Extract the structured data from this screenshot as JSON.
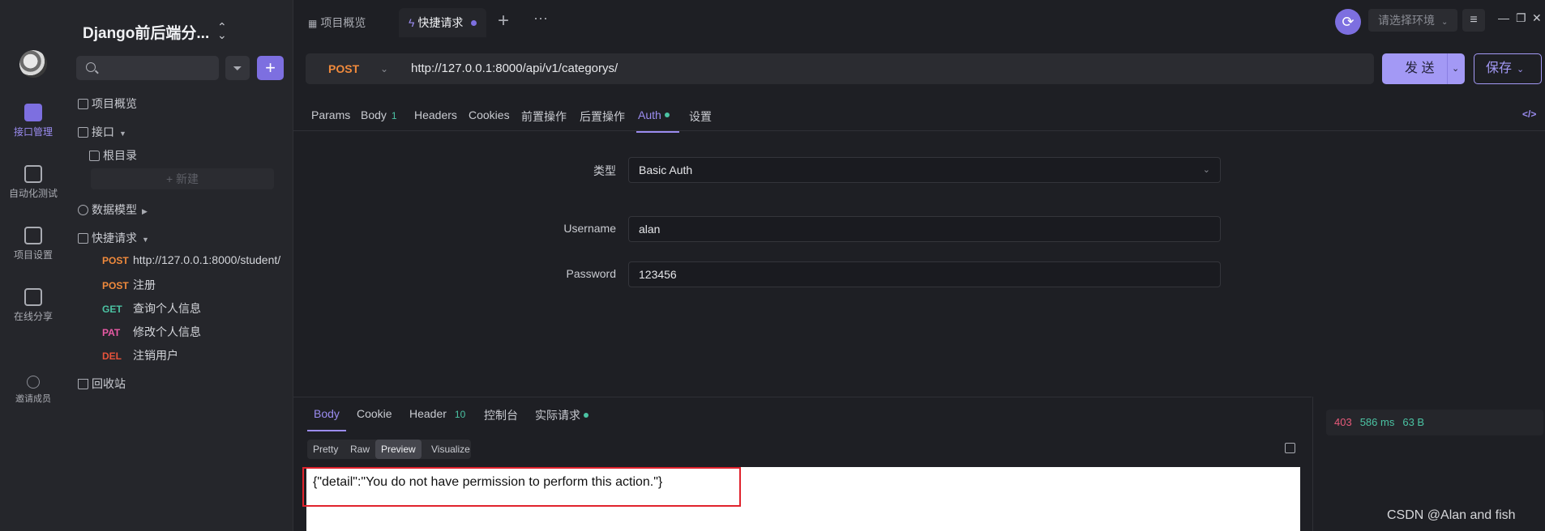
{
  "rail": {
    "items": [
      {
        "label": "接口管理",
        "icon": "api-icon"
      },
      {
        "label": "自动化测试",
        "icon": "automation-icon"
      },
      {
        "label": "项目设置",
        "icon": "settings-icon"
      },
      {
        "label": "在线分享",
        "icon": "share-icon"
      },
      {
        "label": "邀请成员",
        "icon": "invite-icon"
      }
    ]
  },
  "sidebar": {
    "project_title": "Django前后端分...",
    "tree": {
      "overview": "项目概览",
      "apis": "接口",
      "root": "根目录",
      "new": "+ 新建",
      "models": "数据模型",
      "quick": "快捷请求",
      "trash": "回收站"
    },
    "requests": [
      {
        "method": "POST",
        "name": "http://127.0.0.1:8000/student/",
        "color": "#f08a3c"
      },
      {
        "method": "POST",
        "name": "注册",
        "color": "#f08a3c"
      },
      {
        "method": "GET",
        "name": "查询个人信息",
        "color": "#4bc3a3"
      },
      {
        "method": "PAT",
        "name": "修改个人信息",
        "color": "#e85aa5"
      },
      {
        "method": "DEL",
        "name": "注销用户",
        "color": "#e8533b"
      }
    ]
  },
  "tabs": {
    "overview": "项目概览",
    "quick": "快捷请求",
    "plus": "+",
    "more": "···"
  },
  "env": {
    "placeholder": "请选择环境"
  },
  "request": {
    "method": "POST",
    "url": "http://127.0.0.1:8000/api/v1/categorys/",
    "send": "发 送",
    "save": "保存"
  },
  "req_tabs": {
    "params": "Params",
    "body": "Body",
    "body_count": "1",
    "headers": "Headers",
    "cookies": "Cookies",
    "pre": "前置操作",
    "post": "后置操作",
    "auth": "Auth",
    "settings": "设置"
  },
  "auth": {
    "type_label": "类型",
    "type_value": "Basic Auth",
    "username_label": "Username",
    "username_value": "alan",
    "password_label": "Password",
    "password_value": "123456"
  },
  "response": {
    "tabs": {
      "body": "Body",
      "cookie": "Cookie",
      "header": "Header",
      "header_count": "10",
      "console": "控制台",
      "actual": "实际请求"
    },
    "formats": [
      "Pretty",
      "Raw",
      "Preview",
      "Visualize"
    ],
    "active_format": "Preview",
    "body": "{\"detail\":\"You do not have permission to perform this action.\"}",
    "status": "403",
    "time": "586 ms",
    "size": "63 B"
  },
  "watermark": "CSDN @Alan and fish",
  "colors": {
    "accent": "#7d6fe0",
    "post": "#f08a3c",
    "get": "#4bc3a3",
    "patch": "#e85aa5",
    "delete": "#e8533b",
    "error": "#e85a7a",
    "highlight_box": "#e0232d"
  }
}
